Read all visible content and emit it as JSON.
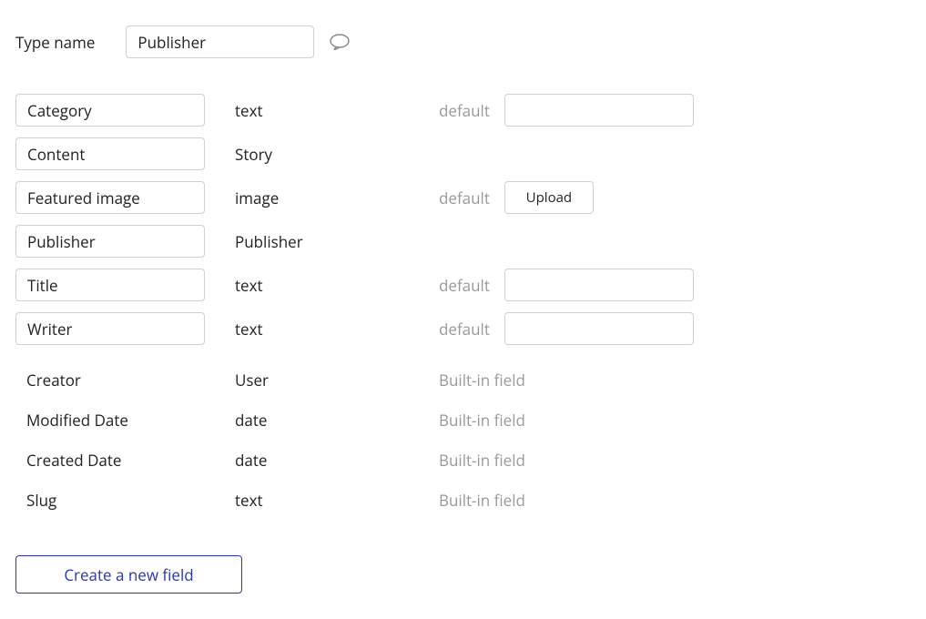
{
  "header": {
    "label": "Type name",
    "value": "Publisher"
  },
  "fields": [
    {
      "name": "Category",
      "type": "text",
      "default_kind": "input"
    },
    {
      "name": "Content",
      "type": "Story",
      "default_kind": "none"
    },
    {
      "name": "Featured image",
      "type": "image",
      "default_kind": "upload"
    },
    {
      "name": "Publisher",
      "type": "Publisher",
      "default_kind": "none"
    },
    {
      "name": "Title",
      "type": "text",
      "default_kind": "input"
    },
    {
      "name": "Writer",
      "type": "text",
      "default_kind": "input"
    }
  ],
  "builtin_fields": [
    {
      "name": "Creator",
      "type": "User"
    },
    {
      "name": "Modified Date",
      "type": "date"
    },
    {
      "name": "Created Date",
      "type": "date"
    },
    {
      "name": "Slug",
      "type": "text"
    }
  ],
  "labels": {
    "default": "default",
    "builtin": "Built-in field",
    "upload": "Upload",
    "create_field": "Create a new field"
  }
}
